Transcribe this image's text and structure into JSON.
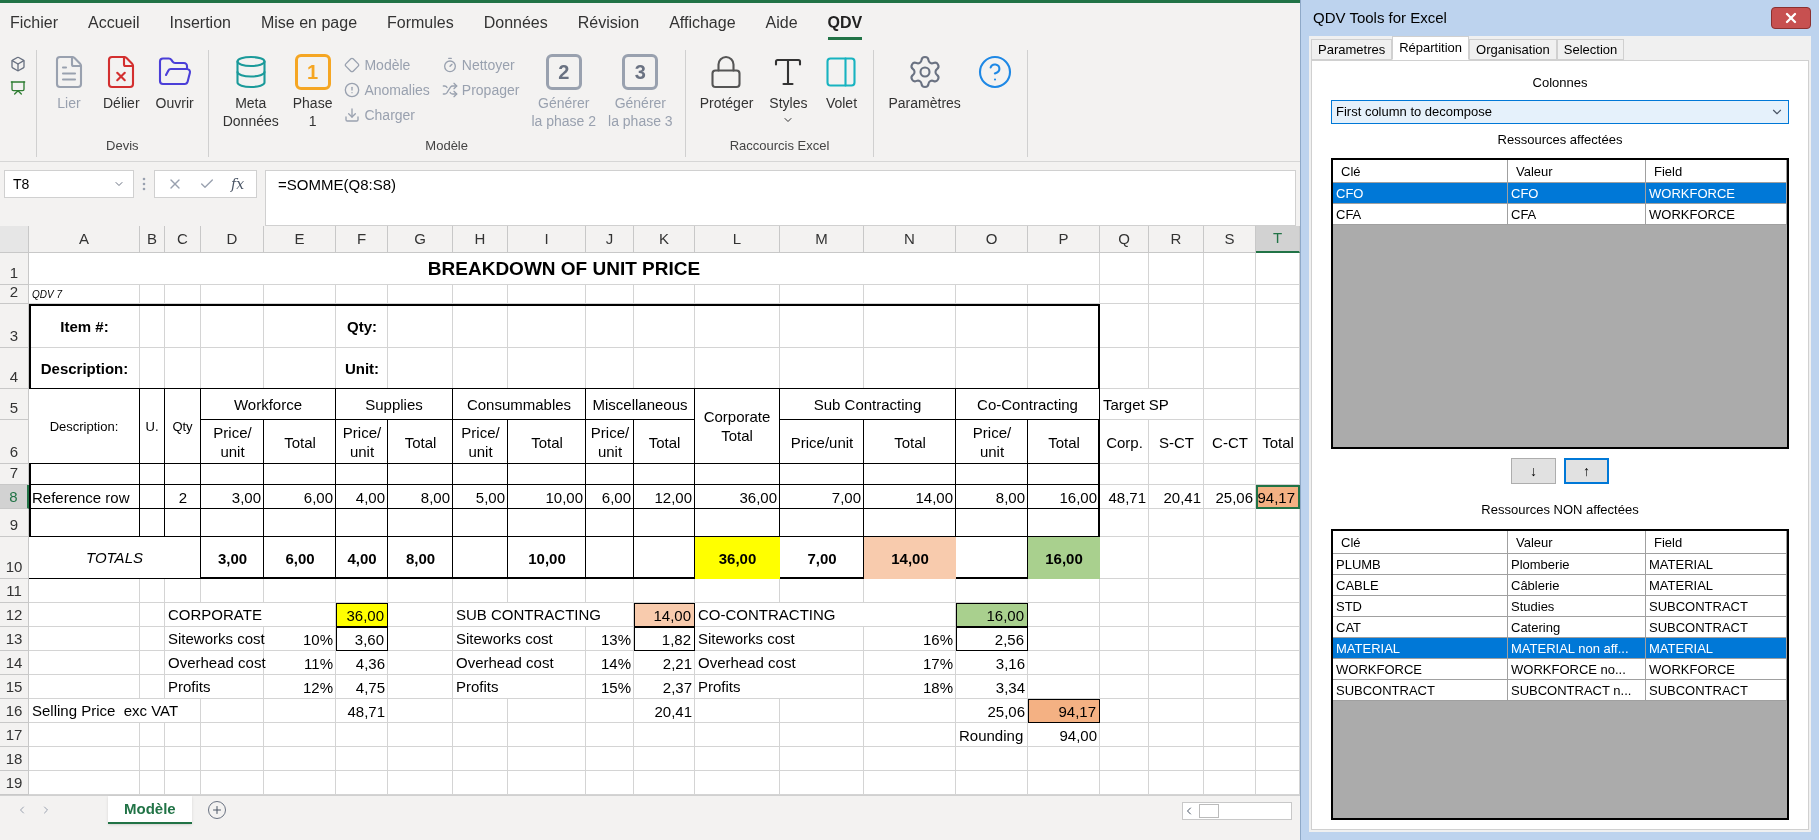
{
  "ribbon": {
    "tabs": [
      {
        "label": "Fichier",
        "selected": false
      },
      {
        "label": "Accueil",
        "selected": false
      },
      {
        "label": "Insertion",
        "selected": false
      },
      {
        "label": "Mise en page",
        "selected": false
      },
      {
        "label": "Formules",
        "selected": false
      },
      {
        "label": "Données",
        "selected": false
      },
      {
        "label": "Révision",
        "selected": false
      },
      {
        "label": "Affichage",
        "selected": false
      },
      {
        "label": "Aide",
        "selected": false
      },
      {
        "label": "QDV",
        "selected": true
      }
    ],
    "groups": [
      {
        "label": "Devis",
        "items": [
          {
            "kind": "large",
            "label": "Lier",
            "disabled": true
          },
          {
            "kind": "large",
            "label": "Délier",
            "disabled": false
          },
          {
            "kind": "large",
            "label": "Ouvrir",
            "disabled": false
          }
        ]
      },
      {
        "label": "Modèle",
        "items": [
          {
            "kind": "large",
            "label": "Meta\nDonnées",
            "disabled": false
          },
          {
            "kind": "numbered",
            "label": "Phase\n1",
            "badge": "1",
            "disabled": false
          },
          {
            "kind": "stack",
            "buttons": [
              {
                "label": "Modèle",
                "disabled": true
              },
              {
                "label": "Anomalies",
                "disabled": true
              },
              {
                "label": "Charger",
                "disabled": true
              }
            ]
          },
          {
            "kind": "stack",
            "buttons": [
              {
                "label": "Nettoyer",
                "disabled": true
              },
              {
                "label": "Propager",
                "disabled": true
              }
            ]
          },
          {
            "kind": "numbered",
            "label": "Générer\nla phase 2",
            "badge": "2",
            "disabled": true
          },
          {
            "kind": "numbered",
            "label": "Générer\nla phase 3",
            "badge": "3",
            "disabled": true
          }
        ]
      },
      {
        "label": "Raccourcis Excel",
        "items": [
          {
            "kind": "large",
            "label": "Protéger",
            "disabled": false
          },
          {
            "kind": "dropdown",
            "label": "Styles",
            "disabled": false
          },
          {
            "kind": "large",
            "label": "Volet",
            "disabled": false
          }
        ]
      },
      {
        "items": [
          {
            "kind": "large",
            "label": "Paramètres",
            "disabled": false
          },
          {
            "kind": "icon",
            "disabled": false
          }
        ]
      }
    ]
  },
  "formula_bar": {
    "name_box": "T8",
    "function_label": "fx",
    "formula": "=SOMME(Q8:S8)"
  },
  "sheet": {
    "columns": [
      {
        "label": "A",
        "selected": false
      },
      {
        "label": "B",
        "selected": false
      },
      {
        "label": "C",
        "selected": false
      },
      {
        "label": "D",
        "selected": false
      },
      {
        "label": "E",
        "selected": false
      },
      {
        "label": "F",
        "selected": false
      },
      {
        "label": "G",
        "selected": false
      },
      {
        "label": "H",
        "selected": false
      },
      {
        "label": "I",
        "selected": false
      },
      {
        "label": "J",
        "selected": false
      },
      {
        "label": "K",
        "selected": false
      },
      {
        "label": "L",
        "selected": false
      },
      {
        "label": "M",
        "selected": false
      },
      {
        "label": "N",
        "selected": false
      },
      {
        "label": "O",
        "selected": false
      },
      {
        "label": "P",
        "selected": false
      },
      {
        "label": "Q",
        "selected": false
      },
      {
        "label": "R",
        "selected": false
      },
      {
        "label": "S",
        "selected": false
      },
      {
        "label": "T",
        "selected": true
      }
    ],
    "rows": [
      {
        "label": "1",
        "selected": false,
        "cells": [
          {
            "kind": "title",
            "text": "BREAKDOWN OF UNIT PRICE"
          }
        ]
      },
      {
        "label": "2",
        "selected": false,
        "cells": [
          {
            "kind": "note",
            "text": "QDV 7"
          }
        ]
      },
      {
        "label": "3",
        "selected": false,
        "cells": [
          {
            "kind": "label",
            "text": "Item #:"
          },
          {
            "kind": "label",
            "text": "Qty:"
          }
        ]
      },
      {
        "label": "4",
        "selected": false,
        "cells": [
          {
            "kind": "label",
            "text": "Description:"
          },
          {
            "kind": "label",
            "text": "Unit:"
          }
        ]
      },
      {
        "label": "5",
        "selected": false,
        "cells": [
          {
            "kind": "small",
            "text": "Description:"
          },
          {
            "kind": "small",
            "text": "U."
          },
          {
            "kind": "small",
            "text": "Qty"
          },
          {
            "kind": "head",
            "text": "Workforce"
          },
          {
            "kind": "head",
            "text": "Supplies"
          },
          {
            "kind": "head",
            "text": "Consummables"
          },
          {
            "kind": "head",
            "text": "Miscellaneous"
          },
          {
            "kind": "head",
            "text": "Corporate Total"
          },
          {
            "kind": "head",
            "text": "Sub Contracting"
          },
          {
            "kind": "head",
            "text": "Co-Contracting"
          },
          {
            "kind": "text",
            "text": "Target SP"
          }
        ]
      },
      {
        "label": "6",
        "selected": false,
        "cells": [
          {
            "kind": "head",
            "text": "Price/ unit"
          },
          {
            "kind": "head",
            "text": "Total"
          },
          {
            "kind": "head",
            "text": "Price/ unit"
          },
          {
            "kind": "head",
            "text": "Total"
          },
          {
            "kind": "head",
            "text": "Price/ unit"
          },
          {
            "kind": "head",
            "text": "Total"
          },
          {
            "kind": "head",
            "text": "Price/ unit"
          },
          {
            "kind": "head",
            "text": "Total"
          },
          {
            "kind": "head",
            "text": "Price/unit"
          },
          {
            "kind": "head",
            "text": "Total"
          },
          {
            "kind": "head",
            "text": "Price/ unit"
          },
          {
            "kind": "head",
            "text": "Total"
          },
          {
            "kind": "head",
            "text": "Corp."
          },
          {
            "kind": "head",
            "text": "S-CT"
          },
          {
            "kind": "head",
            "text": "C-CT"
          },
          {
            "kind": "head",
            "text": "Total"
          }
        ]
      },
      {
        "label": "7",
        "selected": false
      },
      {
        "label": "8",
        "selected": true,
        "cells": [
          {
            "kind": "text",
            "text": "Reference row"
          },
          {
            "kind": "head",
            "text": "2"
          },
          {
            "kind": "num",
            "text": "3,00"
          },
          {
            "kind": "num",
            "text": "6,00"
          },
          {
            "kind": "num",
            "text": "4,00"
          },
          {
            "kind": "num",
            "text": "8,00"
          },
          {
            "kind": "num",
            "text": "5,00"
          },
          {
            "kind": "num",
            "text": "10,00"
          },
          {
            "kind": "num",
            "text": "6,00"
          },
          {
            "kind": "num",
            "text": "12,00"
          },
          {
            "kind": "num",
            "text": "36,00"
          },
          {
            "kind": "num",
            "text": "7,00"
          },
          {
            "kind": "num",
            "text": "14,00"
          },
          {
            "kind": "num",
            "text": "8,00"
          },
          {
            "kind": "num",
            "text": "16,00"
          },
          {
            "kind": "num",
            "text": "48,71"
          },
          {
            "kind": "num",
            "text": "20,41"
          },
          {
            "kind": "num",
            "text": "25,06"
          },
          {
            "kind": "num",
            "text": "94,17",
            "color": "#f4b183",
            "selected": true
          }
        ]
      },
      {
        "label": "9",
        "selected": false
      },
      {
        "label": "10",
        "selected": false,
        "cells": [
          {
            "kind": "italic",
            "text": "TOTALS"
          },
          {
            "kind": "total",
            "text": "3,00"
          },
          {
            "kind": "total",
            "text": "6,00"
          },
          {
            "kind": "total",
            "text": "4,00"
          },
          {
            "kind": "total",
            "text": "8,00"
          },
          {
            "kind": "total",
            "text": "10,00"
          },
          {
            "kind": "total",
            "text": "36,00",
            "color": "#ffff00"
          },
          {
            "kind": "total",
            "text": "7,00"
          },
          {
            "kind": "total",
            "text": "14,00",
            "color": "#f8cbad"
          },
          {
            "kind": "total",
            "text": "16,00",
            "color": "#a9d08e"
          }
        ]
      },
      {
        "label": "11",
        "selected": false
      },
      {
        "label": "12",
        "selected": false,
        "cells": [
          {
            "kind": "text",
            "text": "CORPORATE"
          },
          {
            "kind": "num",
            "text": "36,00",
            "color": "#ffff00",
            "boxed": true
          },
          {
            "kind": "text",
            "text": "SUB CONTRACTING"
          },
          {
            "kind": "num",
            "text": "14,00",
            "color": "#f8cbad",
            "boxed": true
          },
          {
            "kind": "text",
            "text": "CO-CONTRACTING"
          },
          {
            "kind": "num",
            "text": "16,00",
            "color": "#a9d08e",
            "boxed": true
          }
        ]
      },
      {
        "label": "13",
        "selected": false,
        "cells": [
          {
            "kind": "text",
            "text": "Siteworks cost"
          },
          {
            "kind": "num",
            "text": "10%"
          },
          {
            "kind": "num",
            "text": "3,60",
            "boxed": true
          },
          {
            "kind": "text",
            "text": "Siteworks cost"
          },
          {
            "kind": "num",
            "text": "13%"
          },
          {
            "kind": "num",
            "text": "1,82",
            "boxed": true
          },
          {
            "kind": "text",
            "text": "Siteworks cost"
          },
          {
            "kind": "num",
            "text": "16%"
          },
          {
            "kind": "num",
            "text": "2,56",
            "boxed": true
          }
        ]
      },
      {
        "label": "14",
        "selected": false,
        "cells": [
          {
            "kind": "text",
            "text": "Overhead cost"
          },
          {
            "kind": "num",
            "text": "11%"
          },
          {
            "kind": "num",
            "text": "4,36"
          },
          {
            "kind": "text",
            "text": "Overhead cost"
          },
          {
            "kind": "num",
            "text": "14%"
          },
          {
            "kind": "num",
            "text": "2,21"
          },
          {
            "kind": "text",
            "text": "Overhead cost"
          },
          {
            "kind": "num",
            "text": "17%"
          },
          {
            "kind": "num",
            "text": "3,16"
          }
        ]
      },
      {
        "label": "15",
        "selected": false,
        "cells": [
          {
            "kind": "text",
            "text": "Profits"
          },
          {
            "kind": "num",
            "text": "12%"
          },
          {
            "kind": "num",
            "text": "4,75"
          },
          {
            "kind": "text",
            "text": "Profits"
          },
          {
            "kind": "num",
            "text": "15%"
          },
          {
            "kind": "num",
            "text": "2,37"
          },
          {
            "kind": "text",
            "text": "Profits"
          },
          {
            "kind": "num",
            "text": "18%"
          },
          {
            "kind": "num",
            "text": "3,34"
          }
        ]
      },
      {
        "label": "16",
        "selected": false,
        "cells": [
          {
            "kind": "text",
            "text": "Selling Price  exc VAT"
          },
          {
            "kind": "num",
            "text": "48,71"
          },
          {
            "kind": "num",
            "text": "20,41"
          },
          {
            "kind": "num",
            "text": "25,06"
          },
          {
            "kind": "num",
            "text": "94,17",
            "color": "#f4b183",
            "boxed": true
          }
        ]
      },
      {
        "label": "17",
        "selected": false,
        "cells": [
          {
            "kind": "text",
            "text": "Rounding"
          },
          {
            "kind": "num",
            "text": "94,00"
          }
        ]
      },
      {
        "label": "18",
        "selected": false
      },
      {
        "label": "19",
        "selected": false
      }
    ]
  },
  "sheet_tabs": [
    {
      "label": "Modèle",
      "selected": true
    }
  ],
  "dialog": {
    "title": "QDV Tools for Excel",
    "tabs": [
      {
        "label": "Parametres",
        "selected": false
      },
      {
        "label": "Répartition",
        "selected": true
      },
      {
        "label": "Organisation",
        "selected": false
      },
      {
        "label": "Selection",
        "selected": false
      }
    ],
    "columns_label": "Colonnes",
    "column_select": "First column to decompose",
    "assigned": {
      "label": "Ressources affectées",
      "columns": [
        "Clé",
        "Valeur",
        "Field"
      ],
      "rows": [
        {
          "cells": [
            "CFO",
            "CFO",
            "WORKFORCE"
          ],
          "selected": true
        },
        {
          "cells": [
            "CFA",
            "CFA",
            "WORKFORCE"
          ],
          "selected": false
        }
      ]
    },
    "move_buttons": [
      {
        "label": "↓",
        "focused": false
      },
      {
        "label": "↑",
        "focused": true
      }
    ],
    "unassigned": {
      "label": "Ressources NON affectées",
      "columns": [
        "Clé",
        "Valeur",
        "Field"
      ],
      "rows": [
        {
          "cells": [
            "PLUMB",
            "Plomberie",
            "MATERIAL"
          ],
          "selected": false
        },
        {
          "cells": [
            "CABLE",
            "Câblerie",
            "MATERIAL"
          ],
          "selected": false
        },
        {
          "cells": [
            "STD",
            "Studies",
            "SUBCONTRACT"
          ],
          "selected": false
        },
        {
          "cells": [
            "CAT",
            "Catering",
            "SUBCONTRACT"
          ],
          "selected": false
        },
        {
          "cells": [
            "MATERIAL",
            "MATERIAL non aff...",
            "MATERIAL"
          ],
          "selected": true
        },
        {
          "cells": [
            "WORKFORCE",
            "WORKFORCE no...",
            "WORKFORCE"
          ],
          "selected": false
        },
        {
          "cells": [
            "SUBCONTRACT",
            "SUBCONTRACT n...",
            "SUBCONTRACT"
          ],
          "selected": false
        }
      ]
    }
  }
}
